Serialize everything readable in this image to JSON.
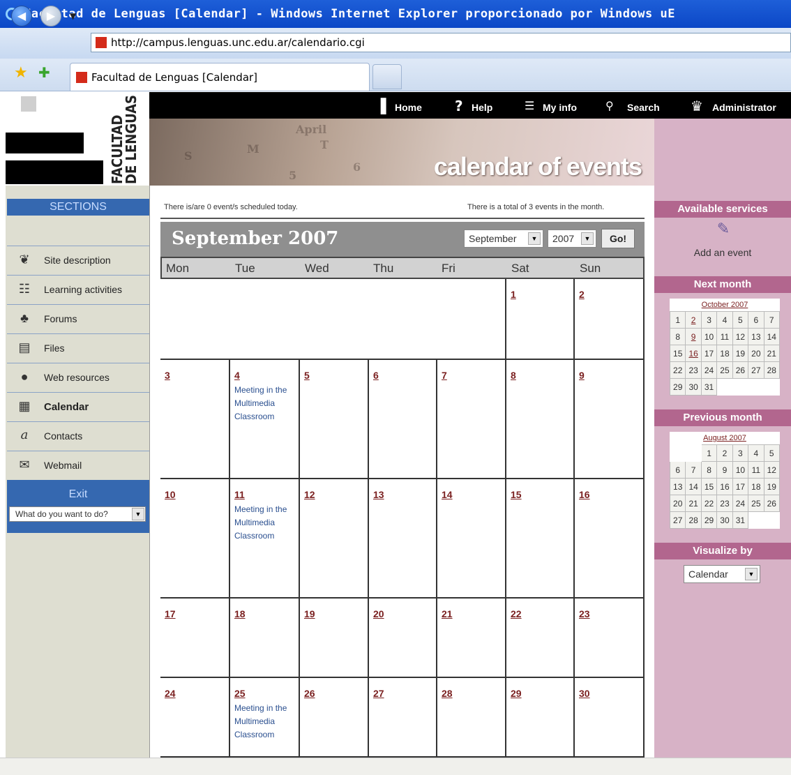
{
  "window": {
    "title": "Facultad de Lenguas [Calendar] - Windows Internet Explorer proporcionado por Windows uE"
  },
  "browser": {
    "url": "http://campus.lenguas.unc.edu.ar/calendario.cgi",
    "tab_title": "Facultad de Lenguas [Calendar]"
  },
  "site": {
    "logo_text": "FACULTAD DE LENGUAS",
    "banner_title": "calendar of events",
    "nav": [
      {
        "label": "Home",
        "icon": "home-icon"
      },
      {
        "label": "Help",
        "icon": "help-icon"
      },
      {
        "label": "My info",
        "icon": "my-info-icon"
      },
      {
        "label": "Search",
        "icon": "search-icon"
      },
      {
        "label": "Administrator",
        "icon": "administrator-icon"
      }
    ]
  },
  "sidebar": {
    "sections_label": "SECTIONS",
    "items": [
      {
        "label": "Site description",
        "icon": "site-description-icon"
      },
      {
        "label": "Learning activities",
        "icon": "learning-activities-icon"
      },
      {
        "label": "Forums",
        "icon": "forums-icon"
      },
      {
        "label": "Files",
        "icon": "files-icon"
      },
      {
        "label": "Web resources",
        "icon": "web-resources-icon"
      },
      {
        "label": "Calendar",
        "icon": "calendar-icon",
        "active": true
      },
      {
        "label": "Contacts",
        "icon": "contacts-icon"
      },
      {
        "label": "Webmail",
        "icon": "webmail-icon"
      }
    ],
    "exit_label": "Exit",
    "exit_select": "What do you want to do?"
  },
  "calendar": {
    "today_info": "There is/are 0 event/s scheduled today.",
    "month_info": "There is a total of 3 events in the month.",
    "title": "September 2007",
    "month_select": "September",
    "year_select": "2007",
    "go_label": "Go!",
    "weekdays": [
      "Mon",
      "Tue",
      "Wed",
      "Thu",
      "Fri",
      "Sat",
      "Sun"
    ],
    "weeks": [
      [
        null,
        null,
        null,
        null,
        null,
        "1",
        "2"
      ],
      [
        "3",
        "4",
        "5",
        "6",
        "7",
        "8",
        "9"
      ],
      [
        "10",
        "11",
        "12",
        "13",
        "14",
        "15",
        "16"
      ],
      [
        "17",
        "18",
        "19",
        "20",
        "21",
        "22",
        "23"
      ],
      [
        "24",
        "25",
        "26",
        "27",
        "28",
        "29",
        "30"
      ]
    ],
    "events": [
      {
        "day": "4",
        "text": "Meeting in the Multimedia Classroom"
      },
      {
        "day": "11",
        "text": "Meeting in the Multimedia Classroom"
      },
      {
        "day": "25",
        "text": "Meeting in the Multimedia Classroom"
      }
    ]
  },
  "right": {
    "available_services": "Available services",
    "add_event": "Add an event",
    "next_month_label": "Next month",
    "next_month": {
      "caption": "October 2007",
      "weeks": [
        [
          "1",
          "2",
          "3",
          "4",
          "5",
          "6",
          "7"
        ],
        [
          "8",
          "9",
          "10",
          "11",
          "12",
          "13",
          "14"
        ],
        [
          "15",
          "16",
          "17",
          "18",
          "19",
          "20",
          "21"
        ],
        [
          "22",
          "23",
          "24",
          "25",
          "26",
          "27",
          "28"
        ],
        [
          "29",
          "30",
          "31",
          "",
          "",
          "",
          ""
        ]
      ],
      "underlined": [
        "2",
        "9",
        "16"
      ]
    },
    "previous_month_label": "Previous month",
    "previous_month": {
      "caption": "August 2007",
      "weeks": [
        [
          "",
          "",
          "1",
          "2",
          "3",
          "4",
          "5"
        ],
        [
          "6",
          "7",
          "8",
          "9",
          "10",
          "11",
          "12"
        ],
        [
          "13",
          "14",
          "15",
          "16",
          "17",
          "18",
          "19"
        ],
        [
          "20",
          "21",
          "22",
          "23",
          "24",
          "25",
          "26"
        ],
        [
          "27",
          "28",
          "29",
          "30",
          "31",
          "",
          ""
        ]
      ],
      "underlined": []
    },
    "visualize_label": "Visualize by",
    "visualize_select": "Calendar"
  }
}
